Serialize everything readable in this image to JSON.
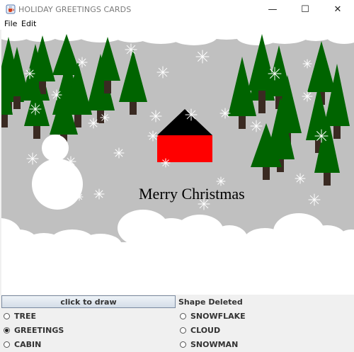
{
  "window": {
    "title": "HOLIDAY GREETINGS CARDS",
    "minimize_glyph": "—",
    "maximize_glyph": "☐",
    "close_glyph": "✕",
    "app_icon": "java-cup-icon"
  },
  "menu": {
    "items": [
      {
        "label": "File"
      },
      {
        "label": "Edit"
      }
    ]
  },
  "canvas": {
    "greeting": "Merry Christmas",
    "colors": {
      "background": "#c0c0c0",
      "tree": "#006400",
      "trunk": "#3a2a22",
      "roof": "#000000",
      "house": "#ff0000",
      "snow": "#ffffff"
    }
  },
  "controls": {
    "draw_button": "click to draw",
    "status": "Shape Deleted",
    "options": [
      {
        "label": "TREE",
        "selected": false
      },
      {
        "label": "SNOWFLAKE",
        "selected": false
      },
      {
        "label": "GREETINGS",
        "selected": true
      },
      {
        "label": "CLOUD",
        "selected": false
      },
      {
        "label": "CABIN",
        "selected": false
      },
      {
        "label": "SNOWMAN",
        "selected": false
      }
    ]
  }
}
